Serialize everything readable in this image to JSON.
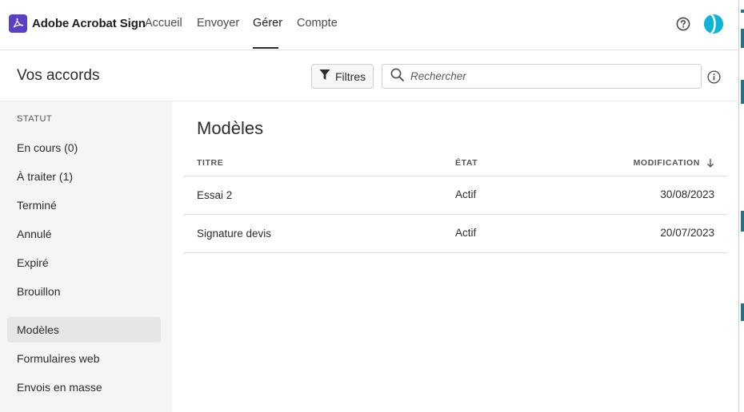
{
  "app": {
    "name": "Adobe Acrobat Sign"
  },
  "nav": {
    "tabs": [
      {
        "label": "Accueil",
        "active": false
      },
      {
        "label": "Envoyer",
        "active": false
      },
      {
        "label": "Gérer",
        "active": true
      },
      {
        "label": "Compte",
        "active": false
      }
    ]
  },
  "header": {
    "title": "Vos accords",
    "filter_label": "Filtres",
    "search_placeholder": "Rechercher",
    "search_value": ""
  },
  "sidebar": {
    "status_heading": "STATUT",
    "items": [
      {
        "label": "En cours (0)",
        "active": false
      },
      {
        "label": "À traiter (1)",
        "active": false
      },
      {
        "label": "Terminé",
        "active": false
      },
      {
        "label": "Annulé",
        "active": false
      },
      {
        "label": "Expiré",
        "active": false
      },
      {
        "label": "Brouillon",
        "active": false
      },
      {
        "label": "Modèles",
        "active": true
      },
      {
        "label": "Formulaires web",
        "active": false
      },
      {
        "label": "Envois en masse",
        "active": false
      }
    ]
  },
  "main": {
    "section_title": "Modèles",
    "columns": [
      "TITRE",
      "ÉTAT",
      "MODIFICATION"
    ],
    "sort": {
      "column": "MODIFICATION",
      "direction": "descending"
    },
    "rows": [
      {
        "title": "Essai 2",
        "state": "Actif",
        "modified": "30/08/2023"
      },
      {
        "title": "Signature devis",
        "state": "Actif",
        "modified": "20/07/2023"
      }
    ]
  },
  "icons": {
    "brand": "acrobat-logo-icon",
    "help": "question-circle-icon",
    "filter": "funnel-icon",
    "search": "magnifier-icon",
    "info": "info-circle-icon",
    "sort": "arrow-down-icon"
  },
  "colors": {
    "brand": "#5b3fc4",
    "avatar": "#12b3d8",
    "sidebar_bg": "#f5f5f5",
    "active_item_bg": "#e6e6e6"
  }
}
